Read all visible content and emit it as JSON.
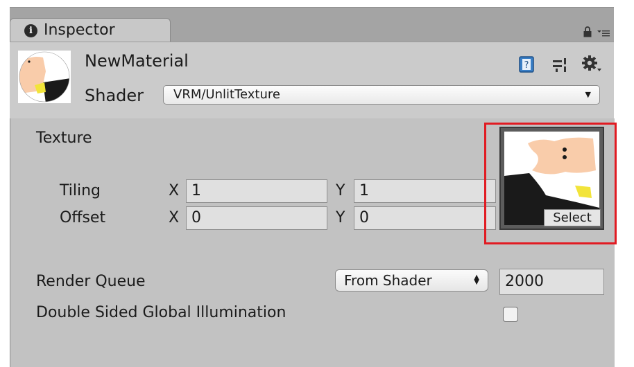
{
  "tab": {
    "label": "Inspector",
    "info_icon": "i"
  },
  "header": {
    "material_name": "NewMaterial",
    "shader_label": "Shader",
    "shader_value": "VRM/UnlitTexture",
    "help_glyph": "?"
  },
  "properties": {
    "texture_label": "Texture",
    "tiling_label": "Tiling",
    "offset_label": "Offset",
    "tiling": {
      "x_label": "X",
      "x": "1",
      "y_label": "Y",
      "y": "1"
    },
    "offset": {
      "x_label": "X",
      "x": "0",
      "y_label": "Y",
      "y": "0"
    },
    "select_label": "Select",
    "render_queue_label": "Render Queue",
    "render_queue_mode": "From Shader",
    "render_queue_value": "2000",
    "double_sided_gi_label": "Double Sided Global Illumination",
    "double_sided_gi_checked": false
  },
  "colors": {
    "highlight": "#e11b22",
    "skin": "#f9ccaa",
    "black": "#1a1a1a",
    "yellow": "#f2e43a"
  }
}
